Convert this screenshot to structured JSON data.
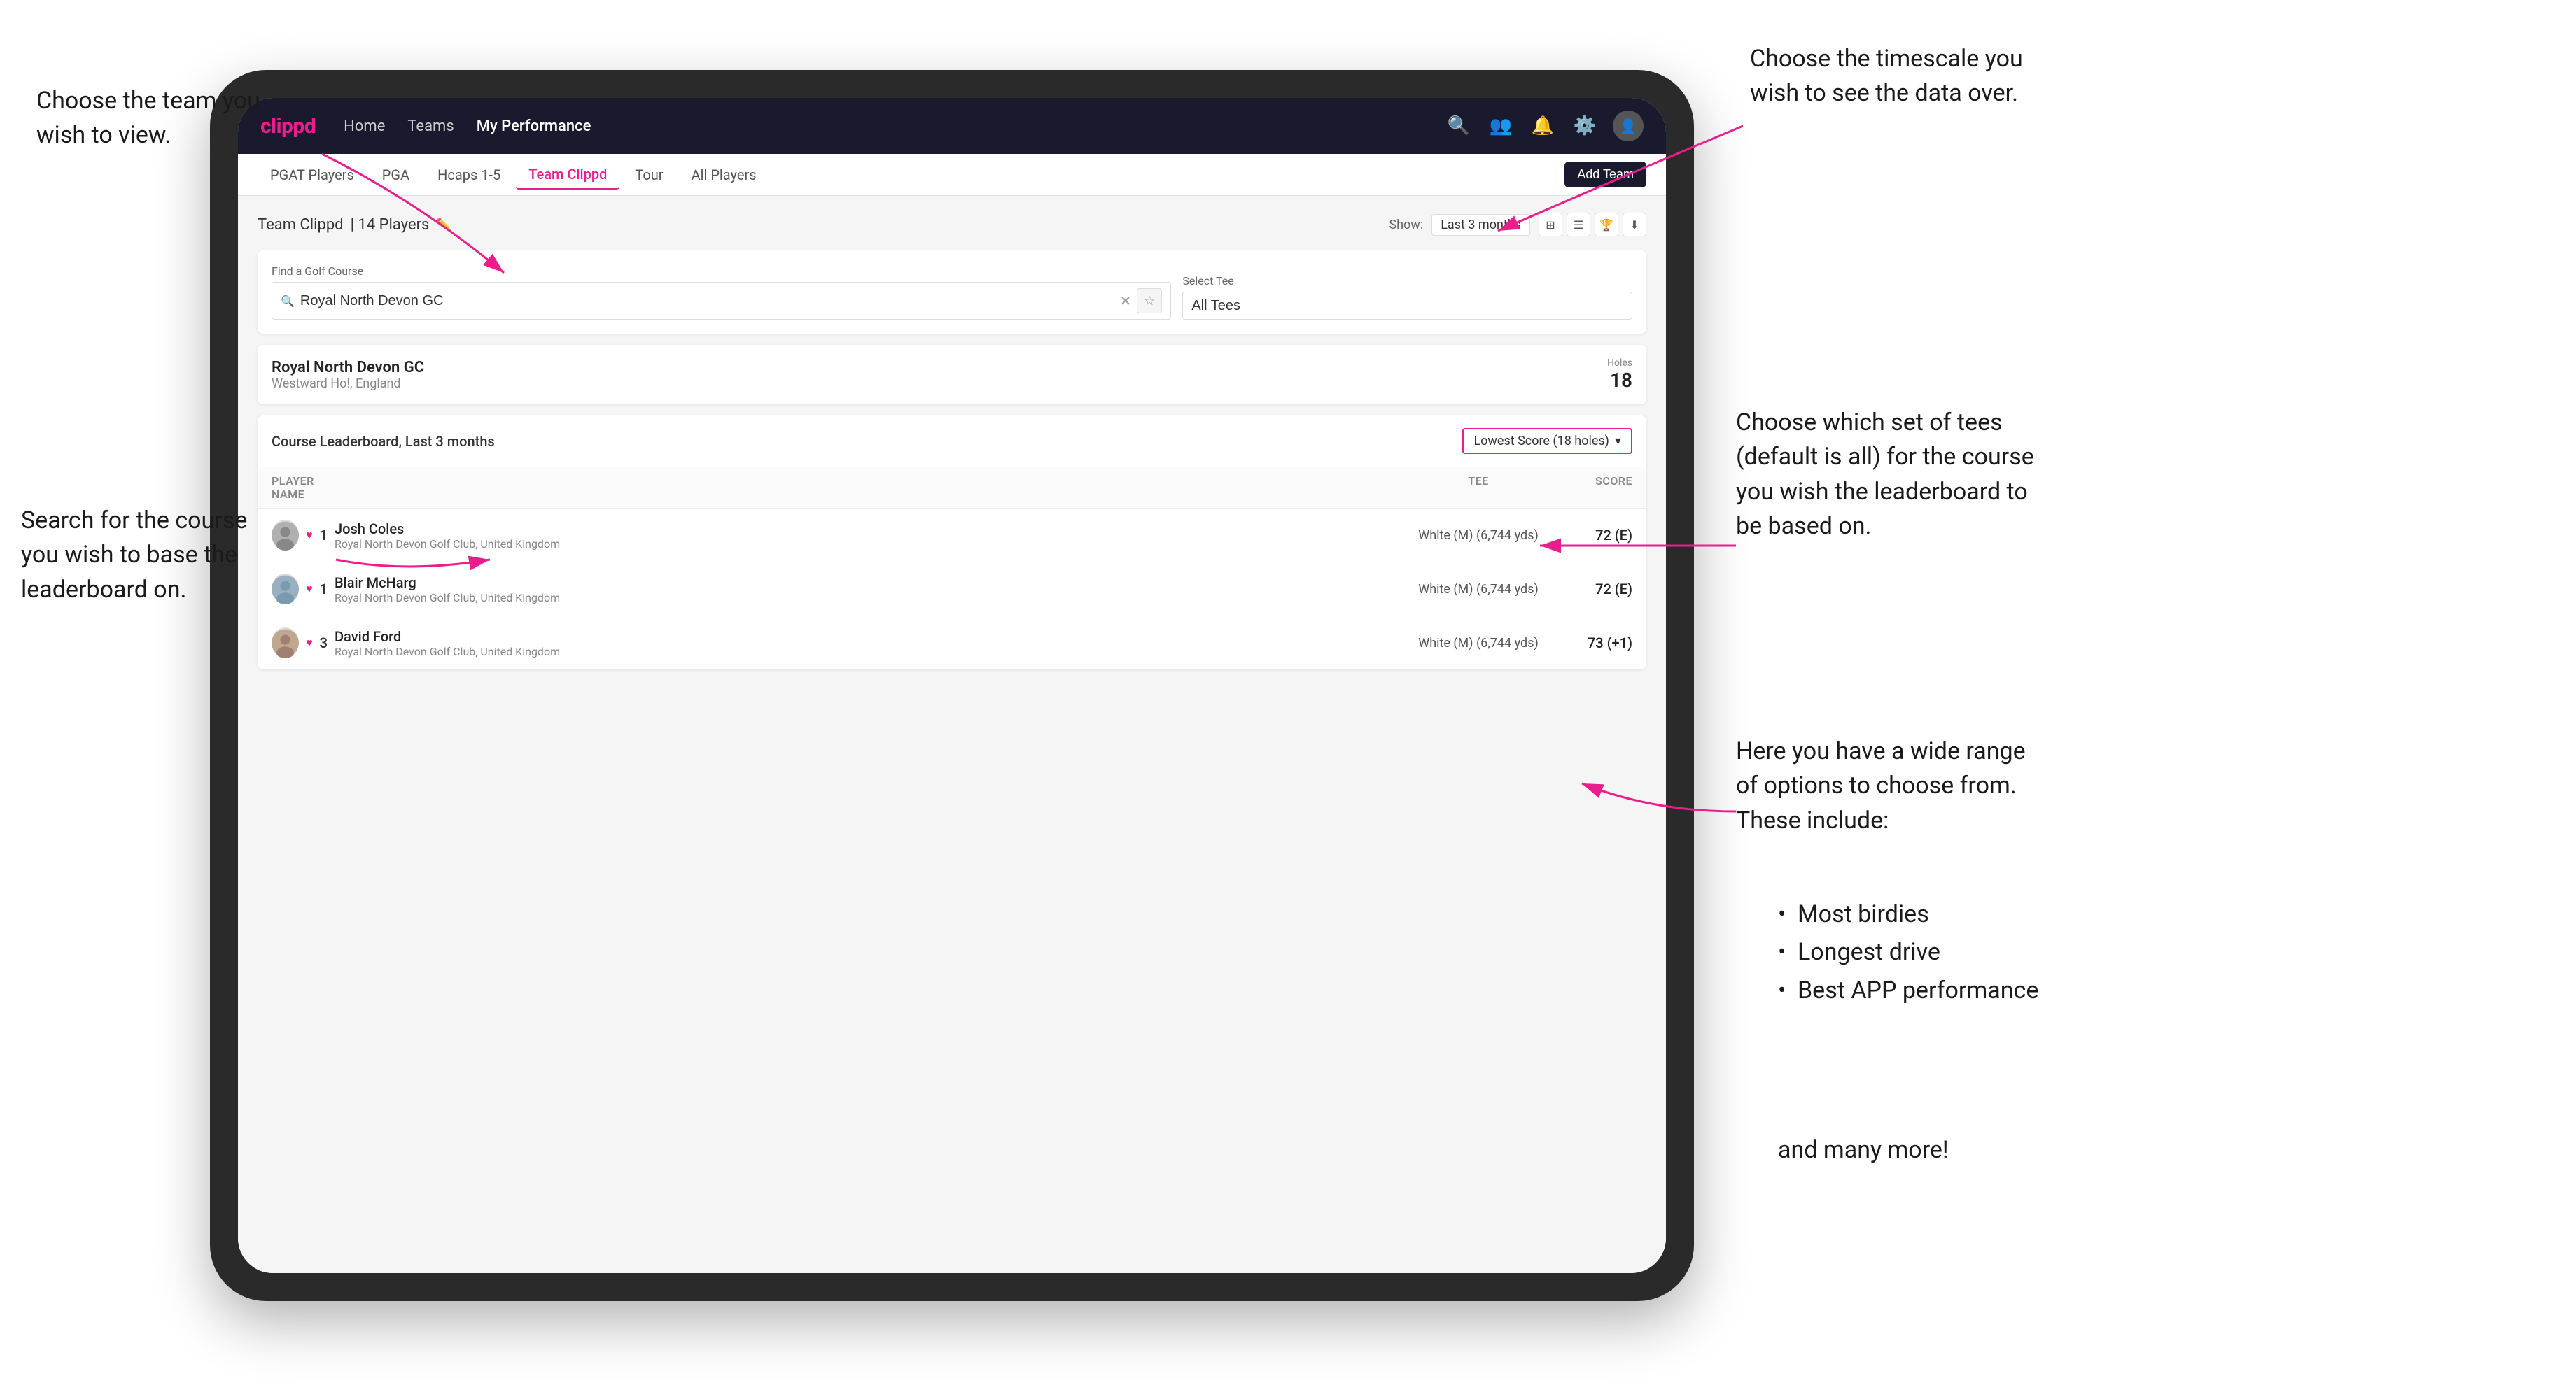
{
  "annotations": {
    "top_left_title": "Choose the team you\nwish to view.",
    "left_title": "Search for the course\nyou wish to base the\nleaderboard on.",
    "top_right_title": "Choose the timescale you\nwish to see the data over.",
    "right_title": "Choose which set of tees\n(default is all) for the course\nyou wish the leaderboard to\nbe based on.",
    "bottom_right_title": "Here you have a wide range\nof options to choose from.\nThese include:",
    "bullet_items": [
      "Most birdies",
      "Longest drive",
      "Best APP performance"
    ],
    "and_more": "and many more!"
  },
  "navbar": {
    "brand": "clippd",
    "links": [
      "Home",
      "Teams",
      "My Performance"
    ],
    "active_link": "My Performance"
  },
  "subnav": {
    "items": [
      "PGAT Players",
      "PGA",
      "Hcaps 1-5",
      "Team Clippd",
      "Tour",
      "All Players"
    ],
    "active_item": "Team Clippd",
    "add_team_label": "Add Team"
  },
  "team_header": {
    "title": "Team Clippd",
    "player_count": "14 Players",
    "show_label": "Show:",
    "show_value": "Last 3 months"
  },
  "search_section": {
    "find_label": "Find a Golf Course",
    "search_placeholder": "Royal North Devon GC",
    "select_tee_label": "Select Tee",
    "tee_value": "All Tees"
  },
  "course_result": {
    "name": "Royal North Devon GC",
    "location": "Westward Ho!, England",
    "holes_label": "Holes",
    "holes_count": "18"
  },
  "leaderboard": {
    "title": "Course Leaderboard,",
    "subtitle": "Last 3 months",
    "sort_label": "Lowest Score (18 holes)",
    "columns": {
      "player": "PLAYER NAME",
      "tee": "TEE",
      "score": "SCORE"
    },
    "rows": [
      {
        "rank": "1",
        "name": "Josh Coles",
        "club": "Royal North Devon Golf Club, United Kingdom",
        "tee": "White (M) (6,744 yds)",
        "score": "72 (E)"
      },
      {
        "rank": "1",
        "name": "Blair McHarg",
        "club": "Royal North Devon Golf Club, United Kingdom",
        "tee": "White (M) (6,744 yds)",
        "score": "72 (E)"
      },
      {
        "rank": "3",
        "name": "David Ford",
        "club": "Royal North Devon Golf Club, United Kingdom",
        "tee": "White (M) (6,744 yds)",
        "score": "73 (+1)"
      }
    ]
  }
}
